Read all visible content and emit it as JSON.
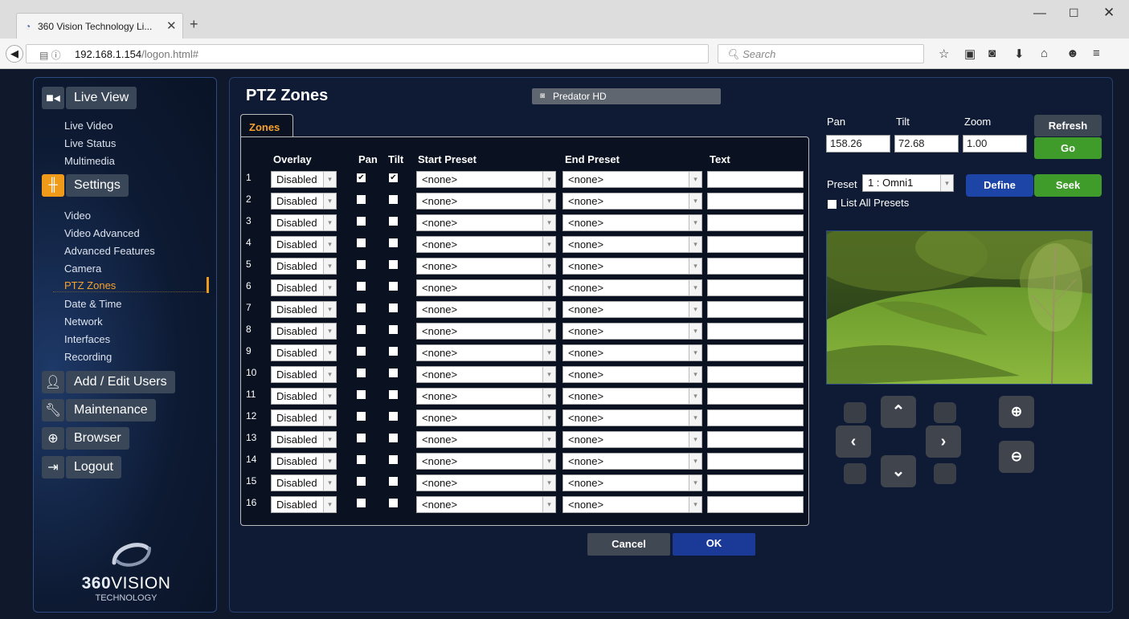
{
  "browser": {
    "tab_title": "360 Vision Technology Li...",
    "url_host": "192.168.1.154",
    "url_path": "/logon.html#",
    "search_placeholder": "Search"
  },
  "sidebar": {
    "live_view": "Live View",
    "live_links": [
      "Live Video",
      "Live Status",
      "Multimedia"
    ],
    "settings": "Settings",
    "settings_links": [
      "Video",
      "Video Advanced",
      "Advanced Features",
      "Camera",
      "PTZ Zones",
      "Date & Time",
      "Network",
      "Interfaces",
      "Recording"
    ],
    "add_edit_users": "Add / Edit Users",
    "maintenance": "Maintenance",
    "browser": "Browser",
    "logout": "Logout",
    "logo_brand_bold": "360",
    "logo_brand": "VISION",
    "logo_sub": "TECHNOLOGY"
  },
  "main": {
    "title": "PTZ Zones",
    "camera_name": "Predator HD",
    "tab_label": "Zones",
    "headers": {
      "overlay": "Overlay",
      "pan": "Pan",
      "tilt": "Tilt",
      "start_preset": "Start Preset",
      "end_preset": "End Preset",
      "text": "Text"
    },
    "rows": [
      {
        "num": "1",
        "overlay": "Disabled",
        "pan": true,
        "tilt": true,
        "start": "<none>",
        "end": "<none>",
        "text": ""
      },
      {
        "num": "2",
        "overlay": "Disabled",
        "pan": false,
        "tilt": false,
        "start": "<none>",
        "end": "<none>",
        "text": ""
      },
      {
        "num": "3",
        "overlay": "Disabled",
        "pan": false,
        "tilt": false,
        "start": "<none>",
        "end": "<none>",
        "text": ""
      },
      {
        "num": "4",
        "overlay": "Disabled",
        "pan": false,
        "tilt": false,
        "start": "<none>",
        "end": "<none>",
        "text": ""
      },
      {
        "num": "5",
        "overlay": "Disabled",
        "pan": false,
        "tilt": false,
        "start": "<none>",
        "end": "<none>",
        "text": ""
      },
      {
        "num": "6",
        "overlay": "Disabled",
        "pan": false,
        "tilt": false,
        "start": "<none>",
        "end": "<none>",
        "text": ""
      },
      {
        "num": "7",
        "overlay": "Disabled",
        "pan": false,
        "tilt": false,
        "start": "<none>",
        "end": "<none>",
        "text": ""
      },
      {
        "num": "8",
        "overlay": "Disabled",
        "pan": false,
        "tilt": false,
        "start": "<none>",
        "end": "<none>",
        "text": ""
      },
      {
        "num": "9",
        "overlay": "Disabled",
        "pan": false,
        "tilt": false,
        "start": "<none>",
        "end": "<none>",
        "text": ""
      },
      {
        "num": "10",
        "overlay": "Disabled",
        "pan": false,
        "tilt": false,
        "start": "<none>",
        "end": "<none>",
        "text": ""
      },
      {
        "num": "11",
        "overlay": "Disabled",
        "pan": false,
        "tilt": false,
        "start": "<none>",
        "end": "<none>",
        "text": ""
      },
      {
        "num": "12",
        "overlay": "Disabled",
        "pan": false,
        "tilt": false,
        "start": "<none>",
        "end": "<none>",
        "text": ""
      },
      {
        "num": "13",
        "overlay": "Disabled",
        "pan": false,
        "tilt": false,
        "start": "<none>",
        "end": "<none>",
        "text": ""
      },
      {
        "num": "14",
        "overlay": "Disabled",
        "pan": false,
        "tilt": false,
        "start": "<none>",
        "end": "<none>",
        "text": ""
      },
      {
        "num": "15",
        "overlay": "Disabled",
        "pan": false,
        "tilt": false,
        "start": "<none>",
        "end": "<none>",
        "text": ""
      },
      {
        "num": "16",
        "overlay": "Disabled",
        "pan": false,
        "tilt": false,
        "start": "<none>",
        "end": "<none>",
        "text": ""
      }
    ],
    "cancel_label": "Cancel",
    "ok_label": "OK"
  },
  "ptz": {
    "pan_label": "Pan",
    "tilt_label": "Tilt",
    "zoom_label": "Zoom",
    "pan_value": "158.26",
    "tilt_value": "72.68",
    "zoom_value": "1.00",
    "refresh_label": "Refresh",
    "go_label": "Go",
    "preset_label": "Preset",
    "preset_value": "1 : Omni1",
    "define_label": "Define",
    "seek_label": "Seek",
    "list_all_label": "List All Presets",
    "list_all_checked": false
  },
  "colors": {
    "accent_orange": "#f6a22c",
    "go_green": "#3f9b2a",
    "define_blue": "#1d45a8",
    "page_bg": "#10182c"
  }
}
